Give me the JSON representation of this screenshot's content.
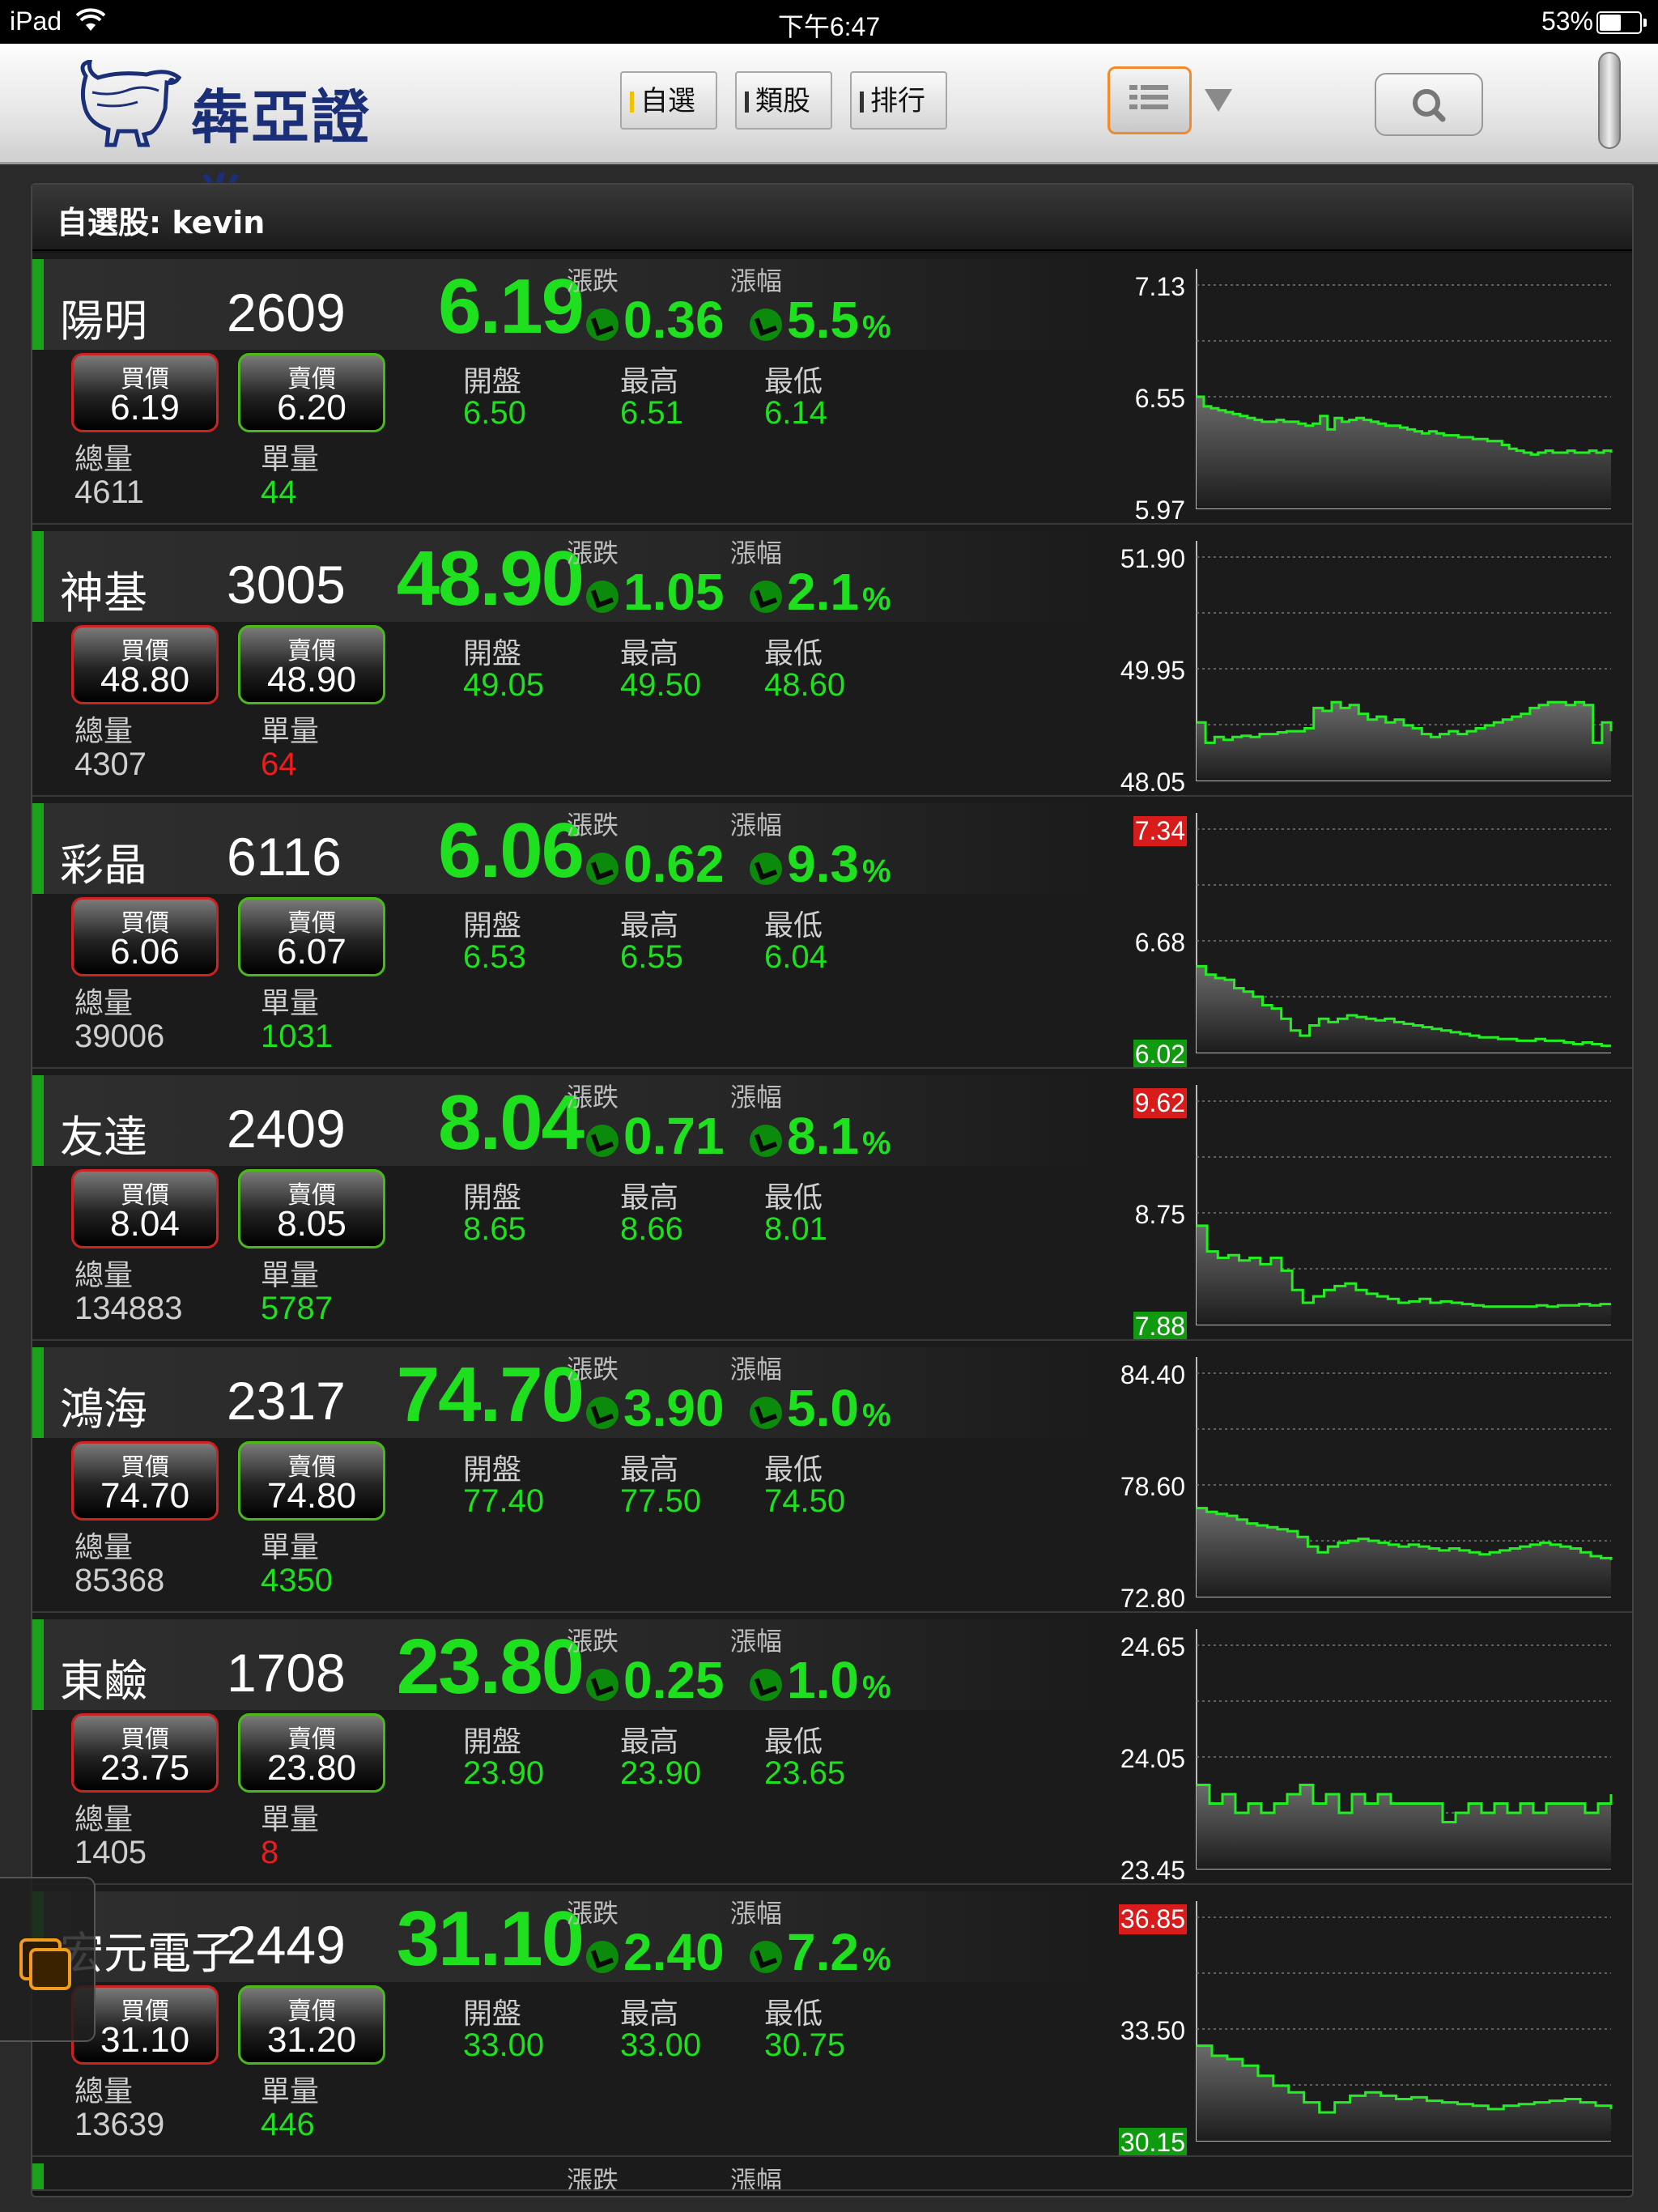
{
  "status_bar": {
    "device": "iPad",
    "time": "下午6:47",
    "battery": "53%"
  },
  "header": {
    "brand": "犇亞證券",
    "tabs": [
      {
        "label": "自選",
        "active": true
      },
      {
        "label": "類股",
        "active": false
      },
      {
        "label": "排行",
        "active": false
      }
    ],
    "icons": {
      "list": "list-icon",
      "dropdown": "dropdown-icon",
      "search": "search-icon"
    }
  },
  "watchlist": {
    "title": "自選股: kevin",
    "labels": {
      "change": "漲跌",
      "change_pct": "漲幅",
      "bid": "買價",
      "ask": "賣價",
      "open": "開盤",
      "high": "最高",
      "low": "最低",
      "total_vol": "總量",
      "last_vol": "單量",
      "pct_sign": "%"
    },
    "stocks": [
      {
        "name": "陽明",
        "code": "2609",
        "price": "6.19",
        "change": "0.36",
        "change_pct": "5.5",
        "bid": "6.19",
        "ask": "6.20",
        "open": "6.50",
        "high": "6.51",
        "low": "6.14",
        "total_vol": "4611",
        "last_vol": "44",
        "last_vol_color": "#1fe01f",
        "y_labels": [
          "7.13",
          "6.55",
          "5.97"
        ],
        "y_top_hl": false,
        "y_bottom_hl": false,
        "y_range": [
          5.97,
          7.13
        ],
        "series": [
          6.55,
          6.5,
          6.49,
          6.48,
          6.47,
          6.46,
          6.45,
          6.44,
          6.43,
          6.42,
          6.42,
          6.43,
          6.42,
          6.42,
          6.41,
          6.4,
          6.41,
          6.45,
          6.38,
          6.44,
          6.42,
          6.43,
          6.44,
          6.43,
          6.42,
          6.41,
          6.4,
          6.4,
          6.39,
          6.38,
          6.37,
          6.36,
          6.37,
          6.36,
          6.35,
          6.35,
          6.34,
          6.34,
          6.33,
          6.33,
          6.32,
          6.32,
          6.3,
          6.28,
          6.27,
          6.26,
          6.25,
          6.26,
          6.27,
          6.26,
          6.26,
          6.27,
          6.26,
          6.26,
          6.27,
          6.26,
          6.27,
          6.26
        ]
      },
      {
        "name": "神基",
        "code": "3005",
        "price": "48.90",
        "change": "1.05",
        "change_pct": "2.1",
        "bid": "48.80",
        "ask": "48.90",
        "open": "49.05",
        "high": "49.50",
        "low": "48.60",
        "total_vol": "4307",
        "last_vol": "64",
        "last_vol_color": "#ee1c1c",
        "y_labels": [
          "51.90",
          "49.95",
          "48.05"
        ],
        "y_top_hl": false,
        "y_bottom_hl": false,
        "y_range": [
          48.05,
          51.9
        ],
        "series": [
          49.05,
          48.7,
          48.8,
          48.75,
          48.8,
          48.82,
          48.8,
          48.85,
          48.85,
          48.88,
          48.9,
          48.9,
          48.95,
          49.3,
          49.25,
          49.4,
          49.3,
          49.35,
          49.2,
          49.1,
          49.15,
          49.05,
          49.1,
          49.0,
          48.95,
          48.85,
          48.8,
          48.85,
          48.9,
          48.85,
          48.9,
          48.95,
          49.0,
          49.05,
          49.1,
          49.15,
          49.2,
          49.3,
          49.35,
          49.4,
          49.4,
          49.35,
          49.4,
          49.35,
          48.7,
          49.05,
          48.9
        ]
      },
      {
        "name": "彩晶",
        "code": "6116",
        "price": "6.06",
        "change": "0.62",
        "change_pct": "9.3",
        "bid": "6.06",
        "ask": "6.07",
        "open": "6.53",
        "high": "6.55",
        "low": "6.04",
        "total_vol": "39006",
        "last_vol": "1031",
        "last_vol_color": "#1fe01f",
        "y_labels": [
          "7.34",
          "6.68",
          "6.02"
        ],
        "y_top_hl": true,
        "y_bottom_hl": true,
        "y_range": [
          6.02,
          7.34
        ],
        "series": [
          6.53,
          6.48,
          6.46,
          6.45,
          6.4,
          6.38,
          6.35,
          6.3,
          6.28,
          6.22,
          6.15,
          6.12,
          6.18,
          6.22,
          6.2,
          6.22,
          6.24,
          6.23,
          6.22,
          6.21,
          6.22,
          6.2,
          6.19,
          6.18,
          6.17,
          6.16,
          6.15,
          6.14,
          6.13,
          6.12,
          6.11,
          6.11,
          6.1,
          6.1,
          6.09,
          6.09,
          6.1,
          6.09,
          6.09,
          6.08,
          6.07,
          6.08,
          6.07,
          6.06,
          6.06
        ]
      },
      {
        "name": "友達",
        "code": "2409",
        "price": "8.04",
        "change": "0.71",
        "change_pct": "8.1",
        "bid": "8.04",
        "ask": "8.05",
        "open": "8.65",
        "high": "8.66",
        "low": "8.01",
        "total_vol": "134883",
        "last_vol": "5787",
        "last_vol_color": "#1fe01f",
        "y_labels": [
          "9.62",
          "8.75",
          "7.88"
        ],
        "y_top_hl": true,
        "y_bottom_hl": true,
        "y_range": [
          7.88,
          9.62
        ],
        "series": [
          8.65,
          8.45,
          8.4,
          8.42,
          8.38,
          8.4,
          8.35,
          8.4,
          8.3,
          8.15,
          8.05,
          8.1,
          8.15,
          8.18,
          8.2,
          8.15,
          8.12,
          8.1,
          8.08,
          8.05,
          8.06,
          8.08,
          8.05,
          8.06,
          8.05,
          8.04,
          8.03,
          8.02,
          8.02,
          8.02,
          8.02,
          8.02,
          8.03,
          8.02,
          8.03,
          8.03,
          8.04,
          8.03,
          8.04,
          8.04
        ]
      },
      {
        "name": "鴻海",
        "code": "2317",
        "price": "74.70",
        "change": "3.90",
        "change_pct": "5.0",
        "bid": "74.70",
        "ask": "74.80",
        "open": "77.40",
        "high": "77.50",
        "low": "74.50",
        "total_vol": "85368",
        "last_vol": "4350",
        "last_vol_color": "#1fe01f",
        "y_labels": [
          "84.40",
          "78.60",
          "72.80"
        ],
        "y_top_hl": false,
        "y_bottom_hl": false,
        "y_range": [
          72.8,
          84.4
        ],
        "series": [
          77.4,
          77.2,
          77.1,
          77.0,
          76.8,
          76.6,
          76.5,
          76.4,
          76.3,
          76.2,
          75.9,
          75.4,
          75.1,
          75.4,
          75.6,
          75.7,
          75.8,
          75.7,
          75.6,
          75.5,
          75.4,
          75.5,
          75.4,
          75.3,
          75.2,
          75.3,
          75.2,
          75.1,
          75.0,
          75.1,
          75.2,
          75.3,
          75.4,
          75.5,
          75.6,
          75.5,
          75.4,
          75.3,
          75.1,
          74.9,
          74.8,
          74.7
        ]
      },
      {
        "name": "東鹼",
        "code": "1708",
        "price": "23.80",
        "change": "0.25",
        "change_pct": "1.0",
        "bid": "23.75",
        "ask": "23.80",
        "open": "23.90",
        "high": "23.90",
        "low": "23.65",
        "total_vol": "1405",
        "last_vol": "8",
        "last_vol_color": "#ee1c1c",
        "y_labels": [
          "24.65",
          "24.05",
          "23.45"
        ],
        "y_top_hl": false,
        "y_bottom_hl": false,
        "y_range": [
          23.45,
          24.65
        ],
        "series": [
          23.9,
          23.8,
          23.85,
          23.75,
          23.8,
          23.75,
          23.8,
          23.85,
          23.9,
          23.8,
          23.85,
          23.75,
          23.85,
          23.8,
          23.85,
          23.8,
          23.8,
          23.8,
          23.8,
          23.7,
          23.75,
          23.8,
          23.75,
          23.8,
          23.75,
          23.8,
          23.75,
          23.8,
          23.8,
          23.8,
          23.75,
          23.8,
          23.85
        ]
      },
      {
        "name": "宏元電子",
        "code": "2449",
        "price": "31.10",
        "change": "2.40",
        "change_pct": "7.2",
        "bid": "31.10",
        "ask": "31.20",
        "open": "33.00",
        "high": "33.00",
        "low": "30.75",
        "total_vol": "13639",
        "last_vol": "446",
        "last_vol_color": "#1fe01f",
        "y_labels": [
          "36.85",
          "33.50",
          "30.15"
        ],
        "y_top_hl": true,
        "y_bottom_hl": true,
        "y_range": [
          30.15,
          36.85
        ],
        "series": [
          33.0,
          32.7,
          32.6,
          32.4,
          32.1,
          31.8,
          31.6,
          31.3,
          31.0,
          31.3,
          31.5,
          31.6,
          31.5,
          31.4,
          31.45,
          31.35,
          31.3,
          31.25,
          31.2,
          31.1,
          31.2,
          31.25,
          31.3,
          31.35,
          31.4,
          31.3,
          31.2,
          31.1
        ]
      }
    ],
    "partial_row": {
      "label_change": "漲跌",
      "label_pct": "漲幅"
    }
  }
}
